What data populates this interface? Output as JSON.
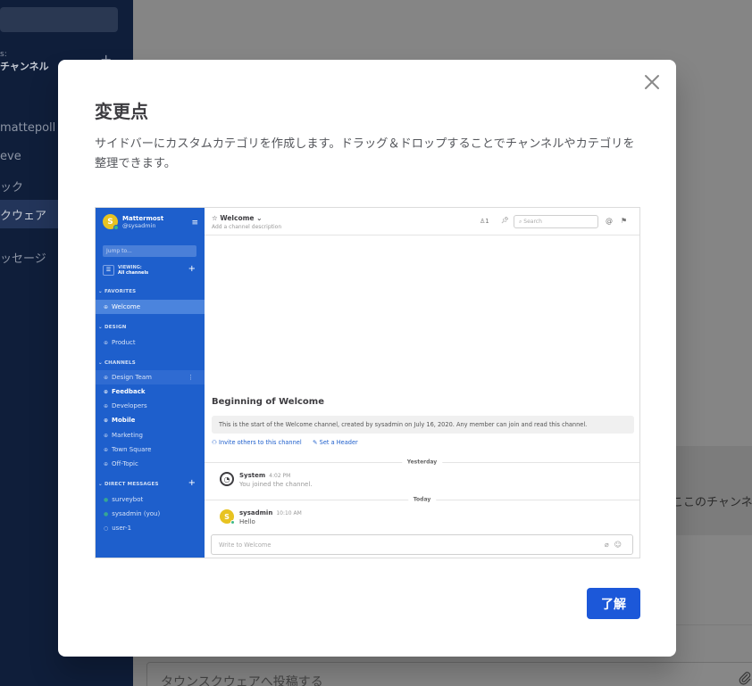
{
  "background": {
    "sidebar": {
      "category_label": "チャンネル",
      "category_label_prefix": "s:",
      "items": [
        "mattepoll",
        "eve",
        "ック",
        "クウェア",
        "ッセージ"
      ],
      "add_icon": "plus-icon"
    },
    "banner_text": "ここのチャンネ",
    "post_placeholder": "タウンスクウェアへ投稿する",
    "attach_icon": "paperclip-icon"
  },
  "modal": {
    "title": "変更点",
    "description": "サイドバーにカスタムカテゴリを作成します。ドラッグ＆ドロップすることでチャンネルやカテゴリを整理できます。",
    "close_icon": "close-icon",
    "ok_label": "了解",
    "accent_color": "#1c58d9"
  },
  "preview": {
    "sidebar_color": "#1e5fcc",
    "team": {
      "initial": "S",
      "name": "Mattermost",
      "user": "@sysadmin"
    },
    "jump_placeholder": "Jump to...",
    "viewing": {
      "label": "VIEWING:",
      "value": "All channels"
    },
    "favorites": {
      "title": "FAVORITES",
      "items": [
        {
          "label": "Welcome",
          "state": "active"
        }
      ]
    },
    "design": {
      "title": "DESIGN",
      "items": [
        {
          "label": "Product",
          "state": "normal"
        }
      ]
    },
    "channels": {
      "title": "CHANNELS",
      "items": [
        {
          "label": "Design Team",
          "state": "hover"
        },
        {
          "label": "Feedback",
          "state": "unread"
        },
        {
          "label": "Developers",
          "state": "normal"
        },
        {
          "label": "Mobile",
          "state": "unread"
        },
        {
          "label": "Marketing",
          "state": "normal"
        },
        {
          "label": "Town Square",
          "state": "normal"
        },
        {
          "label": "Off-Topic",
          "state": "normal"
        }
      ]
    },
    "direct_messages": {
      "title": "DIRECT MESSAGES",
      "items": [
        {
          "label": "surveybot",
          "status": "online"
        },
        {
          "label": "sysadmin (you)",
          "status": "online"
        },
        {
          "label": "user-1",
          "status": "offline"
        }
      ]
    },
    "header": {
      "channel": "Welcome",
      "description": "Add a channel description",
      "member_count": "1",
      "search_placeholder": "Search"
    },
    "intro": {
      "title": "Beginning of Welcome",
      "text": "This is the start of the Welcome channel, created by sysadmin on July 16, 2020. Any member can join and read this channel.",
      "invite_label": "Invite others to this channel",
      "header_label": "Set a Header"
    },
    "separators": {
      "yesterday": "Yesterday",
      "today": "Today"
    },
    "posts": [
      {
        "author": "System",
        "time": "4:02 PM",
        "text": "You joined the channel."
      },
      {
        "author": "sysadmin",
        "time": "10:10 AM",
        "text": "Hello",
        "initial": "S"
      }
    ],
    "composer_placeholder": "Write to Welcome"
  }
}
